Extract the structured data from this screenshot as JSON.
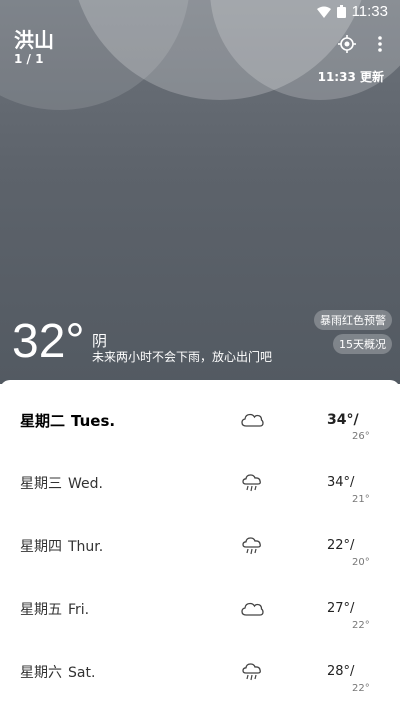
{
  "status_bar": {
    "time": "11:33"
  },
  "location": {
    "city": "洪山",
    "page_indicator": "1 / 1"
  },
  "header": {
    "update_time": "11:33 更新"
  },
  "current": {
    "temperature": "32°",
    "condition": "阴",
    "forecast_text": "未来两小时不会下雨，放心出门吧"
  },
  "badges": {
    "alert": "暴雨红色预警",
    "fifteen_day": "15天概况"
  },
  "days": [
    {
      "zh": "星期二",
      "en": "Tues.",
      "icon": "cloudy",
      "high": "34°/",
      "low": "26°"
    },
    {
      "zh": "星期三",
      "en": "Wed.",
      "icon": "rain",
      "high": "34°/",
      "low": "21°"
    },
    {
      "zh": "星期四",
      "en": "Thur.",
      "icon": "rain",
      "high": "22°/",
      "low": "20°"
    },
    {
      "zh": "星期五",
      "en": "Fri.",
      "icon": "cloudy",
      "high": "27°/",
      "low": "22°"
    },
    {
      "zh": "星期六",
      "en": "Sat.",
      "icon": "rain",
      "high": "28°/",
      "low": "22°"
    }
  ],
  "colors": {
    "hero_top": "#6d737b",
    "hero_bottom": "#535a62",
    "sheet": "#ffffff"
  }
}
